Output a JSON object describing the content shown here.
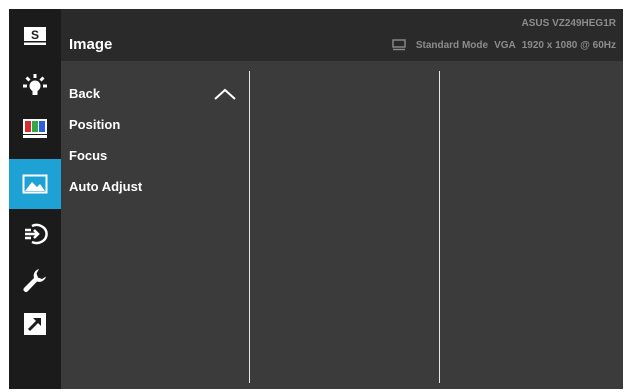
{
  "header": {
    "title": "Image",
    "model": "ASUS  VZ249HEG1R",
    "status": {
      "mode": "Standard Mode",
      "input": "VGA",
      "resolution": "1920 x 1080 @ 60Hz"
    }
  },
  "sidebar": {
    "items": [
      {
        "name": "splendid",
        "icon": "s-badge-icon",
        "label": "S"
      },
      {
        "name": "blue-light",
        "icon": "brightness-bulb-icon"
      },
      {
        "name": "color",
        "icon": "color-bars-icon"
      },
      {
        "name": "image",
        "icon": "landscape-image-icon",
        "active": true
      },
      {
        "name": "input-select",
        "icon": "input-arrow-icon"
      },
      {
        "name": "system-setup",
        "icon": "wrench-icon"
      },
      {
        "name": "shortcut",
        "icon": "shortcut-arrow-icon"
      }
    ]
  },
  "menu": {
    "items": [
      "Back",
      "Position",
      "Focus",
      "Auto Adjust"
    ]
  },
  "colors": {
    "accent": "#1ea2d6",
    "panel": "#3b3b3b",
    "header": "#2a2a2a",
    "rail": "#1b1b1b"
  }
}
